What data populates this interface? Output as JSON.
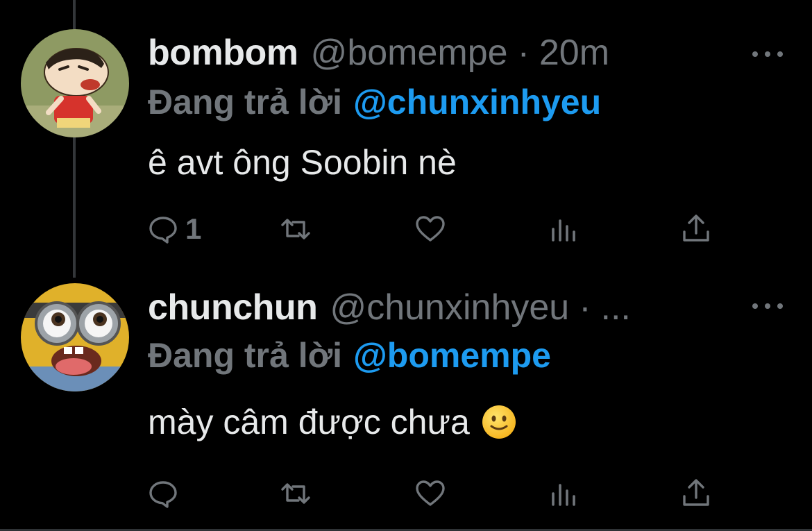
{
  "colors": {
    "background": "#000000",
    "text": "#e7e9ea",
    "muted": "#71767b",
    "mention": "#1d9bf0"
  },
  "tweets": [
    {
      "display_name": "bombom",
      "handle": "@bomempe",
      "separator": "·",
      "time": "20m",
      "reply_prefix": "Đang trả lời",
      "reply_mention": "@chunxinhyeu",
      "text": "ê avt ông Soobin nè",
      "reply_count": "1",
      "avatar_icon": "cartoon-boy-avatar"
    },
    {
      "display_name": "chunchun",
      "handle": "@chunxinhyeu",
      "separator": "·",
      "time": "...",
      "reply_prefix": "Đang trả lời",
      "reply_mention": "@bomempe",
      "text": "mày câm được chưa",
      "emoji": "slightly-smiling-face",
      "reply_count": "",
      "avatar_icon": "minion-avatar"
    }
  ],
  "actions": [
    "reply-icon",
    "retweet-icon",
    "like-icon",
    "views-icon",
    "share-icon"
  ]
}
